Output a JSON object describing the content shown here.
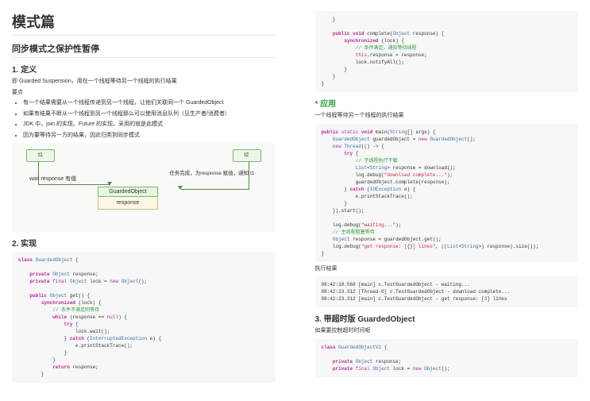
{
  "left": {
    "title": "模式篇",
    "h2_1": "同步模式之保护性暂停",
    "h3_1": "1. 定义",
    "p1": "即 Guarded Suspension，用在一个线程等待另一个线程的执行结果",
    "p2": "要点",
    "bullets": [
      "有一个结果需要从一个线程传递到另一个线程，让他们关联同一个 GuardedObject",
      "如果有结果不断从一个线程到另一个线程那么可以使用消息队列（见生产者/消费者）",
      "JDK 中，join 的实现、Future 的实现，采用的就是此模式",
      "因为要等待另一方的结果，因此归类到同步模式"
    ],
    "diagram": {
      "t1": "t1",
      "t2": "t2",
      "wait_label": "wait response 有值",
      "task_label": "任务完成，为response 赋值，通知 t1",
      "head": "GuardedObject",
      "body": "response"
    },
    "h3_2": "2. 实现",
    "code1": "class GuardedObject {\n\n    private Object response;\n    private final Object lock = new Object();\n\n    public Object get() {\n        synchronized (lock) {\n            // 条件不满足则等待\n            while (response == null) {\n                try {\n                    lock.wait();\n                } catch (InterruptedException e) {\n                    e.printStackTrace();\n                }\n            }\n            return response;\n        }"
  },
  "right": {
    "code_complete": "    }\n\n    public void complete(Object response) {\n        synchronized (lock) {\n            // 条件满足，通知等待线程\n            this.response = response;\n            lock.notifyAll();\n        }\n    }\n}",
    "h3_app": "* 应用",
    "p_app": "一个线程等待另一个线程的执行结果",
    "code_app": "public static void main(String[] args) {\n    GuardedObject guardedObject = new GuardedObject();\n    new Thread(() -> {\n        try {\n            // 子线程执行下载\n            List<String> response = download();\n            log.debug(\"download complete...\");\n            guardedObject.complete(response);\n        } catch (IOException e) {\n            e.printStackTrace();\n        }\n    }).start();\n\n    log.debug(\"waiting...\");\n    // 主线程阻塞等待\n    Object response = guardedObject.get();\n    log.debug(\"get response: [{}] lines\", ((List<String>) response).size());\n}",
    "p_result": "执行结果",
    "code_result": "08:42:18.568 [main] c.TestGuardedObject - waiting...\n08:42:23.312 [Thread-0] c.TestGuardedObject - download complete...\n08:42:23.312 [main] c.TestGuardedObject - get response: [3] lines",
    "h3_timeout": "3. 带超时版 GuardedObject",
    "p_timeout": "如果要控制超时时间呢",
    "code_timeout": "class GuardedObjectV2 {\n\n    private Object response;\n    private final Object lock = new Object();"
  }
}
